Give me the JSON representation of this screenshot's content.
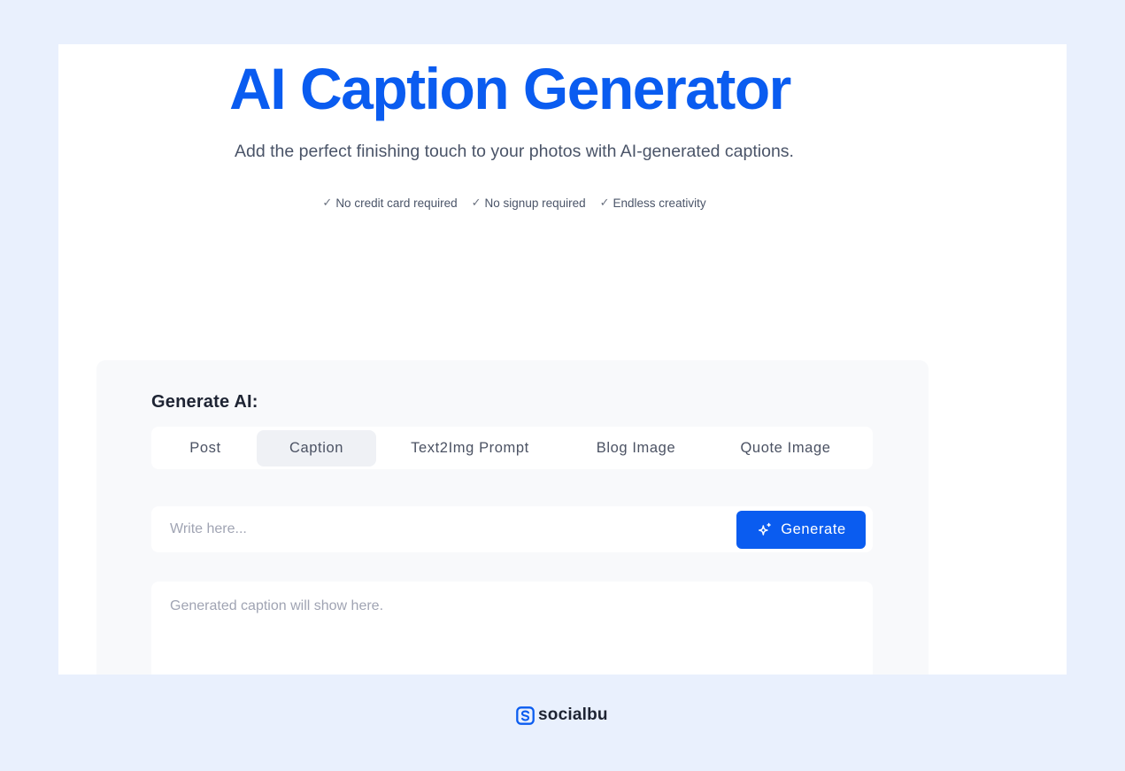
{
  "hero": {
    "title": "AI Caption Generator",
    "subtitle": "Add the perfect finishing touch to your photos with AI-generated captions.",
    "perks": [
      {
        "icon": "check-icon",
        "label": "No credit card required"
      },
      {
        "icon": "check-icon",
        "label": "No signup required"
      },
      {
        "icon": "check-icon",
        "label": "Endless creativity"
      }
    ]
  },
  "generator": {
    "heading": "Generate AI:",
    "tabs": [
      {
        "label": "Post",
        "active": false
      },
      {
        "label": "Caption",
        "active": true
      },
      {
        "label": "Text2Img Prompt",
        "active": false
      },
      {
        "label": "Blog Image",
        "active": false
      },
      {
        "label": "Quote Image",
        "active": false
      }
    ],
    "input": {
      "value": "",
      "placeholder": "Write here..."
    },
    "generate_button": {
      "icon": "sparkle-icon",
      "label": "Generate"
    },
    "output_placeholder": "Generated caption will show here."
  },
  "footer": {
    "brand_icon": "socialbu-logo-icon",
    "brand_name": "socialbu"
  },
  "colors": {
    "accent": "#0a5cf0",
    "background": "#e9f0fd",
    "card": "#f8f9fb",
    "active_tab": "#eff1f5"
  }
}
